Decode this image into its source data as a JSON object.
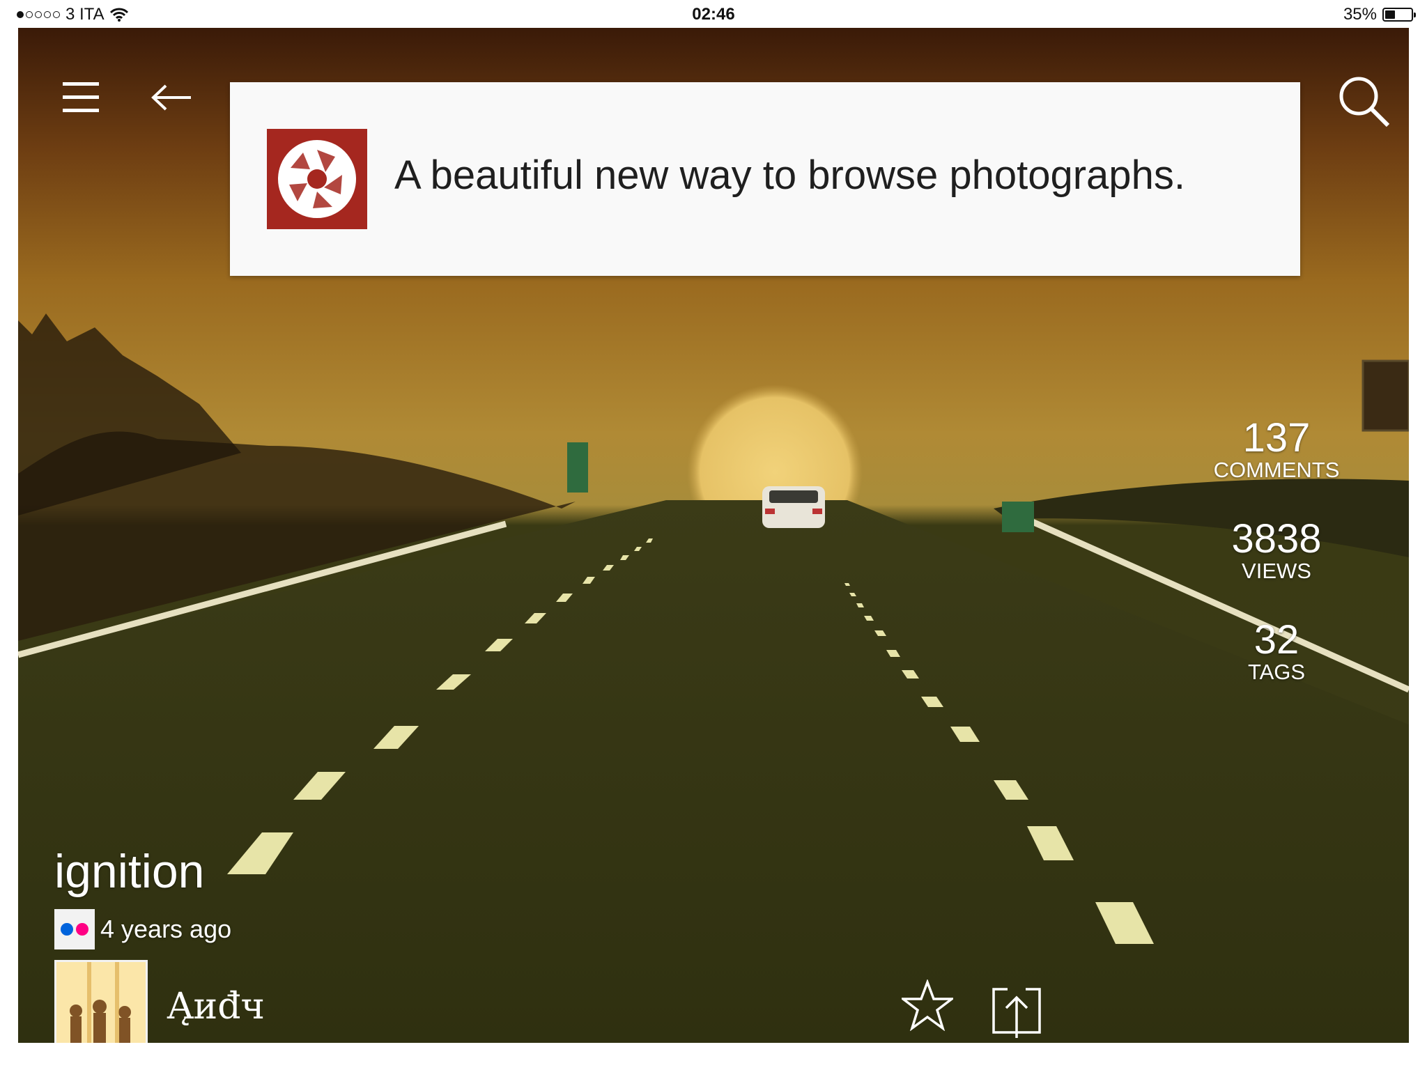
{
  "status_bar": {
    "carrier": "3 ITA",
    "time": "02:46",
    "battery": "35%",
    "battery_level": 0.35
  },
  "banner": {
    "text": "A beautiful new way to browse photographs.",
    "logo_color": "#a5271f"
  },
  "stats": {
    "comments": {
      "value": "137",
      "label": "COMMENTS"
    },
    "views": {
      "value": "3838",
      "label": "VIEWS"
    },
    "tags": {
      "value": "32",
      "label": "TAGS"
    }
  },
  "photo": {
    "title": "ignition",
    "posted": "4 years ago",
    "author": "Ąиđч"
  },
  "icons": {
    "menu": "hamburger-icon",
    "back": "arrow-left-icon",
    "search": "search-icon",
    "favorite": "star-outline-icon",
    "share": "share-icon",
    "source": "flickr-icon"
  },
  "colors": {
    "flickr_blue": "#0063dc",
    "flickr_pink": "#ff0084"
  }
}
